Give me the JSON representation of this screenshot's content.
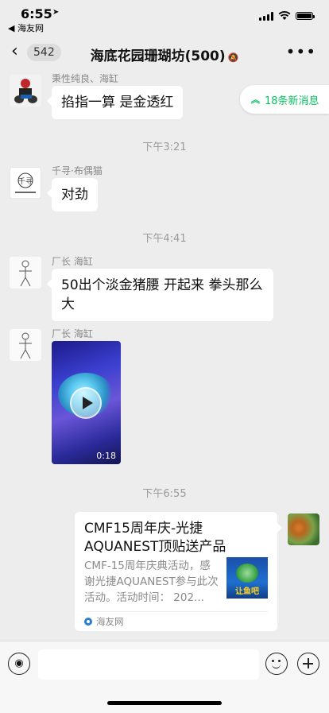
{
  "status_bar": {
    "time": "6:55",
    "back_app": "◀ 海友网"
  },
  "nav": {
    "back_count": "542",
    "title": "海底花园珊瑚坊(500)"
  },
  "new_messages": {
    "label": "18条新消息"
  },
  "messages": [
    {
      "sender": "秉性纯良、海缸",
      "text": "掐指一算 是金透红"
    },
    {
      "timestamp": "下午3:21"
    },
    {
      "sender": "千寻·布偶猫",
      "text": "对劲",
      "avatar_text": "千寻"
    },
    {
      "timestamp": "下午4:41"
    },
    {
      "sender": "厂长 海缸",
      "text": "50出个淡金猪腰 开起来 拳头那么大"
    },
    {
      "sender": "厂长 海缸",
      "video_duration": "0:18"
    },
    {
      "timestamp": "下午6:55"
    }
  ],
  "card": {
    "title": "CMF15周年庆-光捷AQUANEST顶贴送产品",
    "description": "CMF-15周年庆典活动，感谢光捷AQUANEST参与此次活动。活动时间： 202...",
    "source": "海友网",
    "thumb_label": "让鱼吧"
  },
  "colors": {
    "accent": "#07c160",
    "background": "#ededed",
    "bubble": "#ffffff"
  }
}
